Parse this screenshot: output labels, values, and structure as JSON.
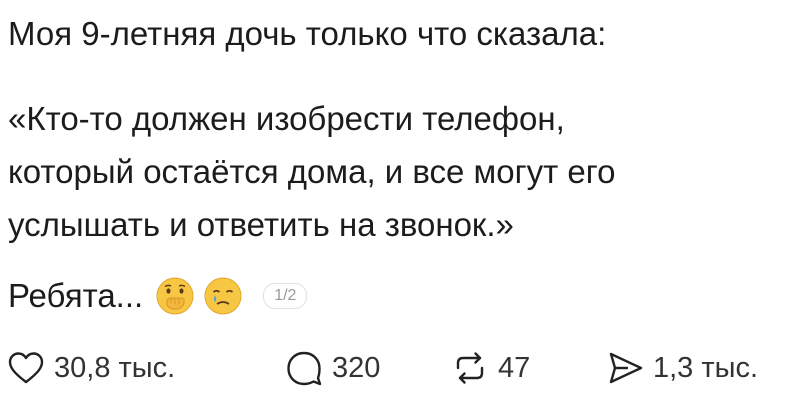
{
  "post": {
    "intro": "Моя 9-летняя дочь только что сказала:",
    "quote_lines": [
      "«Кто-то должен изобрести телефон,",
      "который остаётся дома, и все могут его",
      "услышать и ответить на звонок.»"
    ],
    "reaction_text": "Ребята...",
    "emojis": [
      "hand-over-mouth-emoji",
      "crying-face-emoji"
    ],
    "pager": "1/2"
  },
  "actions": {
    "like": {
      "icon": "heart-icon",
      "count": "30,8 тыс."
    },
    "comment": {
      "icon": "comment-icon",
      "count": "320"
    },
    "repost": {
      "icon": "repost-icon",
      "count": "47"
    },
    "share": {
      "icon": "send-icon",
      "count": "1,3 тыс."
    }
  },
  "colors": {
    "text": "#1c1c1c",
    "muted": "#9a9a9a",
    "emoji_face": "#f7c744"
  }
}
